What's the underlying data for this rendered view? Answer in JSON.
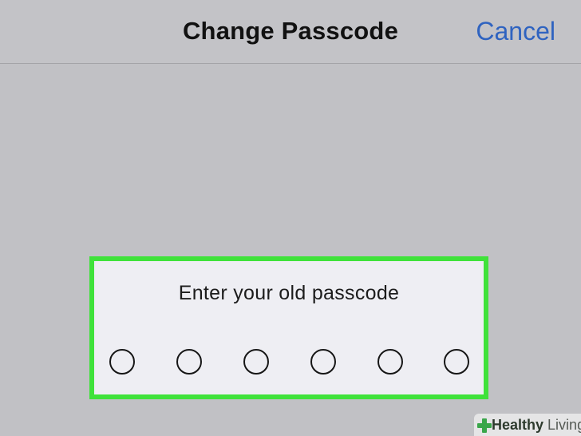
{
  "navbar": {
    "title": "Change Passcode",
    "cancel_label": "Cancel"
  },
  "passcode_prompt": {
    "message": "Enter your old passcode",
    "digits_total": 6,
    "digits_entered": 0
  },
  "watermark": {
    "part1": "Healthy",
    "part2": "Living",
    "icon": "medical-cross-icon"
  },
  "colors": {
    "highlight_border": "#3fe23a",
    "link": "#2f63c0",
    "background": "#c1c1c5",
    "panel": "#eeeef3"
  }
}
